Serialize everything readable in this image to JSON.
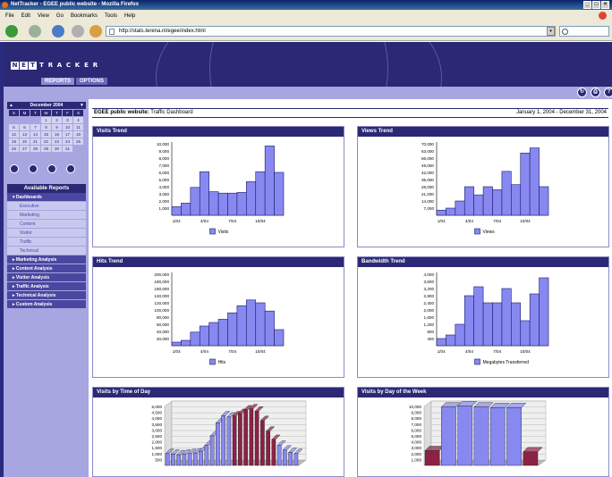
{
  "window": {
    "title": "NetTracker - EGEE public website - Mozilla Firefox",
    "buttons": [
      "_",
      "□",
      "×"
    ]
  },
  "menu": [
    "File",
    "Edit",
    "View",
    "Go",
    "Bookmarks",
    "Tools",
    "Help"
  ],
  "nav": {
    "url": "http://stats.terena.nl/egee/index.html"
  },
  "banner": {
    "logo": [
      "N",
      "E",
      "T",
      "T",
      "R",
      "A",
      "C",
      "K",
      "E",
      "R"
    ],
    "tabs": [
      "REPORTS",
      "OPTIONS"
    ]
  },
  "sidebar": {
    "calendar": {
      "month": "December 2004",
      "days": [
        "S",
        "M",
        "T",
        "W",
        "T",
        "F",
        "S"
      ],
      "rows": [
        [
          "",
          "",
          "",
          "1",
          "2",
          "3",
          "4"
        ],
        [
          "5",
          "6",
          "7",
          "8",
          "9",
          "10",
          "11"
        ],
        [
          "12",
          "13",
          "14",
          "15",
          "16",
          "17",
          "18"
        ],
        [
          "19",
          "20",
          "21",
          "22",
          "23",
          "24",
          "25"
        ],
        [
          "26",
          "27",
          "28",
          "29",
          "30",
          "31",
          ""
        ]
      ]
    },
    "reports_title": "Available Reports",
    "items": [
      {
        "label": "Dashboards",
        "type": "main"
      },
      {
        "label": "Executive",
        "type": "sub"
      },
      {
        "label": "Marketing",
        "type": "sub"
      },
      {
        "label": "Content",
        "type": "sub"
      },
      {
        "label": "Visitor",
        "type": "sub"
      },
      {
        "label": "Traffic",
        "type": "sub"
      },
      {
        "label": "Technical",
        "type": "sub"
      },
      {
        "label": "Marketing Analysis",
        "type": "cat"
      },
      {
        "label": "Content Analysis",
        "type": "cat"
      },
      {
        "label": "Visitor Analysis",
        "type": "cat"
      },
      {
        "label": "Traffic Analysis",
        "type": "cat"
      },
      {
        "label": "Technical Analysis",
        "type": "cat"
      },
      {
        "label": "Custom Analysis",
        "type": "cat"
      }
    ]
  },
  "content": {
    "site_label": "EGEE public website:",
    "dashboard": "Traffic Dashboard",
    "date_range": "January 1, 2004 - December 31, 2004"
  },
  "chart_data": [
    {
      "type": "bar",
      "title": "Visits Trend",
      "yticks": [
        "1,000",
        "2,000",
        "3,000",
        "4,000",
        "5,000",
        "6,000",
        "7,000",
        "8,000",
        "9,000",
        "10,000"
      ],
      "ymax": 10000,
      "xticks": [
        "1/04",
        "4/04",
        "7/04",
        "10/04"
      ],
      "series": [
        {
          "name": "Visits",
          "values": [
            1200,
            1700,
            3900,
            6100,
            3300,
            3100,
            3100,
            3200,
            4700,
            6100,
            9700,
            6000
          ]
        }
      ]
    },
    {
      "type": "bar",
      "title": "Views Trend",
      "yticks": [
        "7,000",
        "14,000",
        "21,000",
        "28,000",
        "35,000",
        "42,000",
        "49,000",
        "56,000",
        "63,000",
        "70,000"
      ],
      "ymax": 70000,
      "xticks": [
        "1/04",
        "4/04",
        "7/04",
        "10/04"
      ],
      "series": [
        {
          "name": "Views",
          "values": [
            5000,
            7000,
            14000,
            28000,
            20000,
            28000,
            25000,
            43000,
            30000,
            61000,
            66000,
            28000
          ]
        }
      ]
    },
    {
      "type": "bar",
      "title": "Hits Trend",
      "yticks": [
        "20,000",
        "40,000",
        "60,000",
        "80,000",
        "100,000",
        "120,000",
        "140,000",
        "160,000",
        "180,000",
        "200,000"
      ],
      "ymax": 200000,
      "xticks": [
        "1/04",
        "4/04",
        "7/04",
        "10/04"
      ],
      "series": [
        {
          "name": "Hits",
          "values": [
            10000,
            15000,
            38000,
            55000,
            65000,
            74000,
            92000,
            112000,
            128000,
            120000,
            97000,
            45000
          ]
        }
      ]
    },
    {
      "type": "bar",
      "title": "Bandwidth Trend",
      "yticks": [
        "400",
        "800",
        "1,200",
        "1,600",
        "2,000",
        "2,400",
        "2,800",
        "3,200",
        "3,600",
        "4,000"
      ],
      "ymax": 4000,
      "xticks": [
        "1/04",
        "4/04",
        "7/04",
        "10/04"
      ],
      "series": [
        {
          "name": "Megabytes Transferred",
          "values": [
            400,
            600,
            1200,
            2800,
            3300,
            2400,
            2400,
            3200,
            2400,
            1400,
            2900,
            3800
          ]
        }
      ]
    },
    {
      "type": "bar",
      "title": "Visits by Time of Day",
      "yticks": [
        "500",
        "1,000",
        "1,500",
        "2,000",
        "2,500",
        "3,000",
        "3,500",
        "4,000",
        "4,500",
        "5,000"
      ],
      "ymax": 5000,
      "series": [
        {
          "name": "",
          "values": [
            1000,
            950,
            900,
            950,
            1000,
            1050,
            1200,
            1700,
            2500,
            3600,
            4200,
            4100,
            4200,
            4400,
            4700,
            4800,
            4600,
            3800,
            2900,
            2200,
            1700,
            1300,
            1100,
            1000
          ]
        }
      ]
    },
    {
      "type": "bar",
      "title": "Visits by Day of the Week",
      "yticks": [
        "1,000",
        "2,000",
        "3,000",
        "4,000",
        "5,000",
        "6,000",
        "7,000",
        "8,000",
        "9,000",
        "10,000"
      ],
      "ymax": 10000,
      "series": [
        {
          "name": "",
          "values": [
            2500,
            9900,
            10100,
            9900,
            9800,
            9800,
            2300
          ]
        }
      ]
    }
  ],
  "colors": {
    "navy": "#2b2875",
    "lavender": "#a7a6e1",
    "bar": "#8889f0",
    "bar_dark": "#1a1a6a",
    "weekend": "#8b2244"
  }
}
